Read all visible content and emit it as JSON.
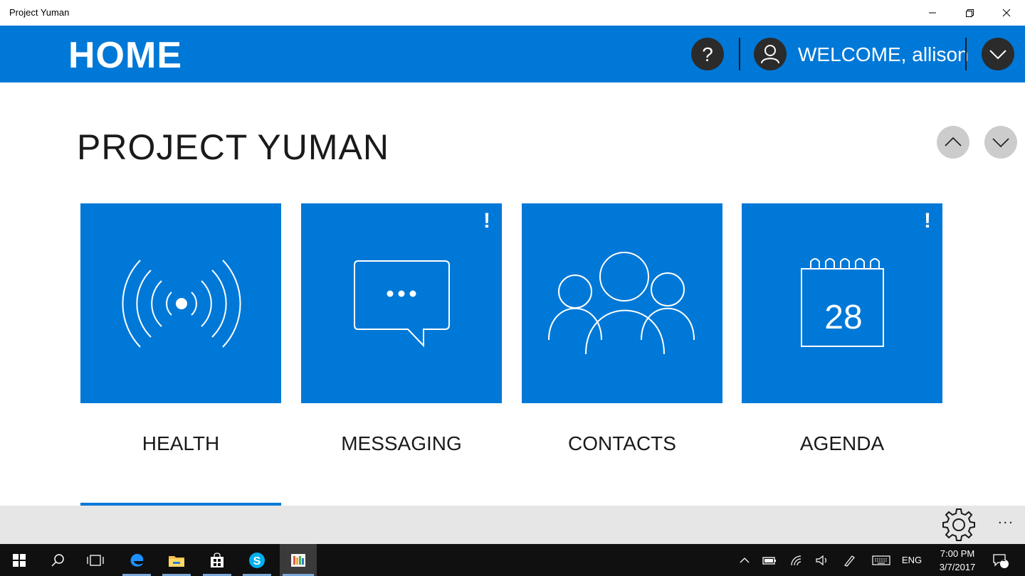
{
  "window": {
    "title": "Project Yuman"
  },
  "header": {
    "title": "HOME",
    "welcome_prefix": "WELCOME,",
    "username": "allison"
  },
  "main": {
    "title": "PROJECT YUMAN",
    "tiles": [
      {
        "label": "HEALTH",
        "icon": "signal-broadcast-icon",
        "alert": ""
      },
      {
        "label": "MESSAGING",
        "icon": "chat-bubble-icon",
        "alert": "!"
      },
      {
        "label": "CONTACTS",
        "icon": "people-group-icon",
        "alert": ""
      },
      {
        "label": "AGENDA",
        "icon": "calendar-icon",
        "alert": "!",
        "calendar_day": "28"
      }
    ],
    "selected_tile": "HEALTH"
  },
  "appbar": {
    "more": "..."
  },
  "taskbar": {
    "language": "ENG",
    "time": "7:00 PM",
    "date": "3/7/2017",
    "notification_count": "1"
  },
  "colors": {
    "accent": "#0078d7",
    "dark_circle": "#2b2b2b",
    "appbar": "#e6e6e6",
    "taskbar": "#101010"
  }
}
